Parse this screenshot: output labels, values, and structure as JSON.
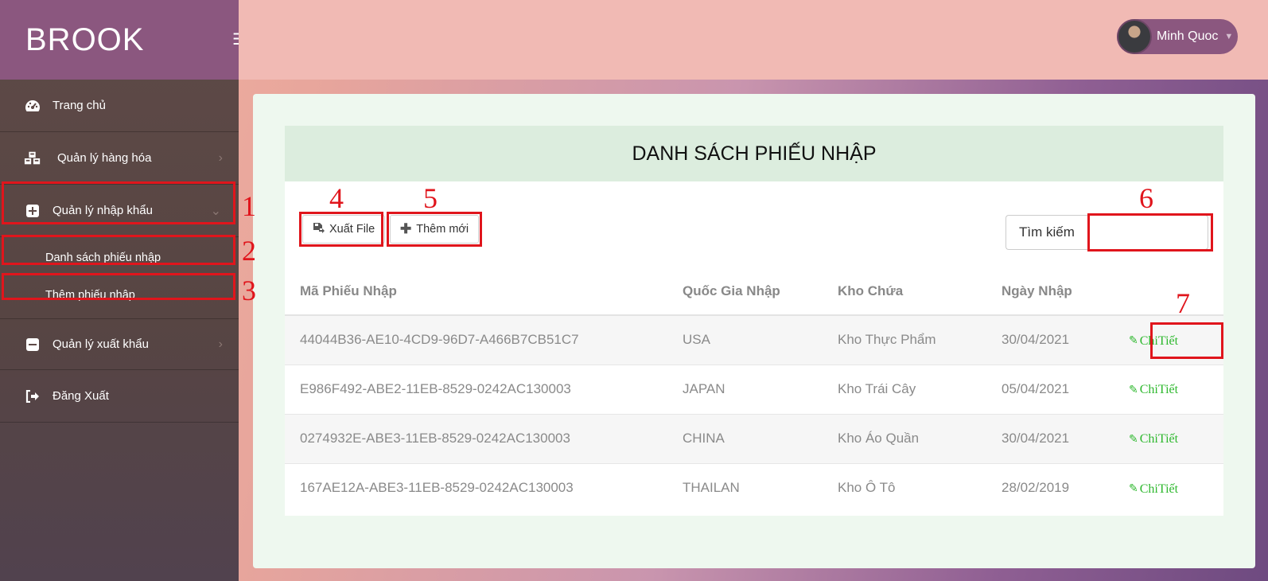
{
  "brand": "BROOK",
  "icons": {
    "menu": "hamburger-icon",
    "dashboard": "tachometer-icon",
    "products": "cubes-icon",
    "import": "plus-square-icon",
    "export": "minus-square-icon",
    "logout": "sign-out-icon",
    "export_file": "file-export-icon",
    "add": "plus-icon",
    "edit": "pencil-icon"
  },
  "colors": {
    "brand": "#8b577f",
    "annotation": "#e0151c",
    "detail_link": "#2eb82e",
    "header_bg": "#dcedde"
  },
  "user": {
    "name": "Minh Quoc"
  },
  "sidebar": {
    "items": [
      {
        "label": "Trang chủ"
      },
      {
        "label": "Quản lý hàng hóa"
      },
      {
        "label": "Quản lý nhập khẩu"
      },
      {
        "label": "Quản lý xuất khẩu"
      },
      {
        "label": "Đăng Xuất"
      }
    ],
    "sub_items": [
      {
        "label": "Danh sách phiếu nhập"
      },
      {
        "label": "Thêm phiếu nhập"
      }
    ]
  },
  "annotations": [
    "1",
    "2",
    "3",
    "4",
    "5",
    "6",
    "7"
  ],
  "main": {
    "title": "DANH SÁCH PHIẾU NHẬP",
    "export_label": "Xuất File",
    "add_label": "Thêm mới",
    "search_label": "Tìm kiếm",
    "search_value": "",
    "columns": [
      "Mã Phiếu Nhập",
      "Quốc Gia Nhập",
      "Kho Chứa",
      "Ngày Nhập"
    ],
    "rows": [
      {
        "id": "44044B36-AE10-4CD9-96D7-A466B7CB51C7",
        "country": "USA",
        "warehouse": "Kho Thực Phẩm",
        "date": "30/04/2021",
        "action": "ChiTiết"
      },
      {
        "id": "E986F492-ABE2-11EB-8529-0242AC130003",
        "country": "JAPAN",
        "warehouse": "Kho Trái Cây",
        "date": "05/04/2021",
        "action": "ChiTiết"
      },
      {
        "id": "0274932E-ABE3-11EB-8529-0242AC130003",
        "country": "CHINA",
        "warehouse": "Kho Áo Quần",
        "date": "30/04/2021",
        "action": "ChiTiết"
      },
      {
        "id": "167AE12A-ABE3-11EB-8529-0242AC130003",
        "country": "THAILAN",
        "warehouse": "Kho Ô Tô",
        "date": "28/02/2019",
        "action": "ChiTiết"
      }
    ]
  }
}
